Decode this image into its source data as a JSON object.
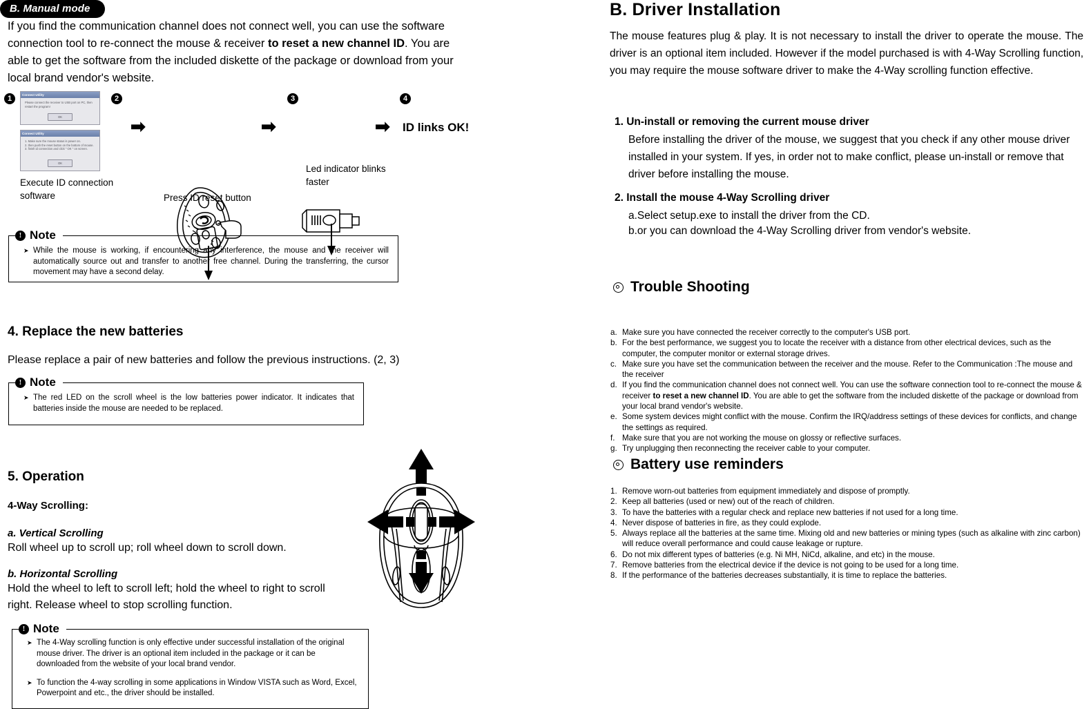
{
  "left": {
    "pill_title": "B. Manual mode",
    "intro_pre": "If you find the communication channel does not connect well, you can use the software connection tool to re-connect the mouse & receiver ",
    "intro_bold": "to reset a new channel ID",
    "intro_post": ".   You are able to get the software from the included diskette of the package or download from your local brand vendor's website.",
    "steps": {
      "n1": "❶",
      "n2": "❷",
      "n3": "❸",
      "n4": "❹",
      "num1": "1",
      "num2": "2",
      "num3": "3",
      "num4": "4",
      "dialog1": {
        "title": "Connect Utility",
        "body": "Please connect the receiver to USB port on PC, then restart the program!",
        "button": "OK"
      },
      "dialog2": {
        "title": "Connect Utility",
        "body": "1. Make sure the mouse status is power on.<br>2. then push the reset button on the bottom of mouse.<br>3. finish id connection and click \" OK \" on screen.",
        "button": "OK"
      },
      "caption1": "Execute ID connection software",
      "caption2": "Press ID reset button",
      "caption3": "Led indicator blinks faster",
      "caption4": "ID links OK!",
      "arrow": "➡"
    },
    "note1": {
      "label": "Note",
      "bang": "!",
      "items": [
        "While the mouse is working, if encountering any interference, the mouse and the receiver will automatically source out and transfer to another free channel.  During the transferring, the cursor movement may have a second delay."
      ]
    },
    "section4": {
      "heading": "4. Replace the new batteries",
      "body": "Please replace a pair of new batteries and follow the previous instructions. (2, 3)"
    },
    "note2": {
      "label": "Note",
      "bang": "!",
      "items": [
        "The red LED on the scroll wheel is the low batteries power indicator.  It indicates that batteries inside the mouse are needed to be replaced."
      ]
    },
    "section5": {
      "heading": "5. Operation",
      "subheading": "4-Way Scrolling:",
      "a_title": "a. Vertical Scrolling",
      "a_body": "Roll wheel up to scroll up; roll wheel down to scroll down.",
      "b_title": "b. Horizontal Scrolling",
      "b_body": "Hold the wheel to left to scroll left; hold the wheel to right to scroll right. Release wheel to stop scrolling function."
    },
    "note3": {
      "label": "Note",
      "bang": "!",
      "items": [
        "The 4-Way scrolling function is only effective under successful installation of the original mouse driver. The driver is an optional item included in the package or it can be downloaded from the website of your local brand vendor.",
        "To function the 4-way scrolling in some applications in Window VISTA such as Word, Excel, Powerpoint and etc., the driver should be installed."
      ]
    }
  },
  "right": {
    "title": "B. Driver Installation",
    "intro": "The mouse features plug & play. It is not necessary to install the driver to operate the mouse. The driver is an optional item included. However if the model purchased is with 4-Way Scrolling function, you may require the mouse software driver to make the 4-Way scrolling function effective.",
    "item1_head": "1. Un-install or removing the current mouse driver",
    "item1_body": "Before installing the driver of the mouse, we suggest that you check if any other mouse driver installed in your system. If yes, in order not to make conflict, please un-install or remove that driver before installing the mouse.",
    "item2_head": "2. Install the mouse 4-Way Scrolling driver",
    "item2_a": "a.Select setup.exe to install the driver from the CD.",
    "item2_b": "b.or you can download the 4-Way Scrolling driver from vendor's website.",
    "trouble_title": "Trouble Shooting",
    "trouble_items": [
      {
        "mark": "a.",
        "text": "Make sure you have connected the receiver correctly to the computer's USB port."
      },
      {
        "mark": "b.",
        "text": "For the best performance, we suggest you to locate the receiver with a distance from other electrical devices, such as the computer, the computer monitor or external storage drives."
      },
      {
        "mark": "c.",
        "text": "Make sure you have set the communication between the receiver and the mouse. Refer to the Communication :The mouse and the receiver"
      },
      {
        "mark": "d.",
        "text": "If you find the communication channel does not connect well.  You can use the software connection tool to re-connect the mouse & receiver <b>to reset a new channel ID</b>.  You are able to get the software from the included diskette of the package or download from your local brand vendor's website."
      },
      {
        "mark": "e.",
        "text": "Some system devices might conflict with the mouse.  Confirm the IRQ/address settings of these devices for conflicts, and change the settings as required."
      },
      {
        "mark": "f.",
        "text": "Make sure that you are not working the mouse on glossy or reflective surfaces."
      },
      {
        "mark": "g.",
        "text": "Try unplugging then reconnecting the receiver cable to your computer."
      }
    ],
    "battery_title": "Battery use reminders",
    "battery_items": [
      {
        "mark": "1.",
        "text": "Remove worn-out batteries from equipment immediately and dispose of promptly."
      },
      {
        "mark": "2.",
        "text": "Keep all batteries (used or new) out of the reach of children."
      },
      {
        "mark": "3.",
        "text": "To have the batteries with a regular check and replace new batteries if not used for a long time."
      },
      {
        "mark": "4.",
        "text": "Never dispose of batteries in fire, as they could explode."
      },
      {
        "mark": "5.",
        "text": "Always replace all the batteries at the same time.  Mixing old and new batteries or mining types (such as alkaline with zinc carbon) will reduce overall performance and could cause leakage or rupture."
      },
      {
        "mark": "6.",
        "text": "Do not mix different types of batteries (e.g. Ni MH, NiCd, alkaline, and etc) in the mouse."
      },
      {
        "mark": "7.",
        "text": "Remove batteries from the electrical device if the device is not going to be used for a long time."
      },
      {
        "mark": "8.",
        "text": "If the performance of the batteries decreases substantially, it is time to replace the batteries."
      }
    ]
  },
  "colors": {
    "ink": "#000000",
    "paper": "#ffffff",
    "dialog_titlebar": "#6b80aa",
    "dialog_face": "#e8e8ec"
  }
}
